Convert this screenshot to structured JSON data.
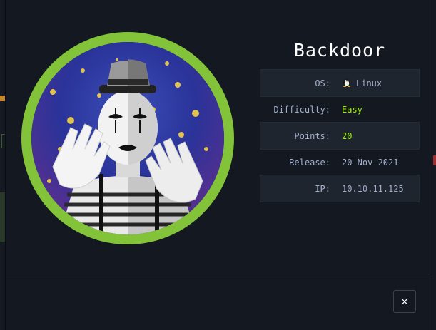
{
  "machine": {
    "name": "Backdoor",
    "info": [
      {
        "label": "OS:",
        "value": "Linux",
        "icon": "linux-penguin-icon"
      },
      {
        "label": "Difficulty:",
        "value": "Easy"
      },
      {
        "label": "Points:",
        "value": "20"
      },
      {
        "label": "Release:",
        "value": "20 Nov 2021"
      },
      {
        "label": "IP:",
        "value": "10.10.11.125"
      }
    ]
  },
  "close": {
    "label": "×"
  },
  "colors": {
    "accent": "#9fef00",
    "ring": "#82c33a",
    "modal_bg": "#141821"
  }
}
